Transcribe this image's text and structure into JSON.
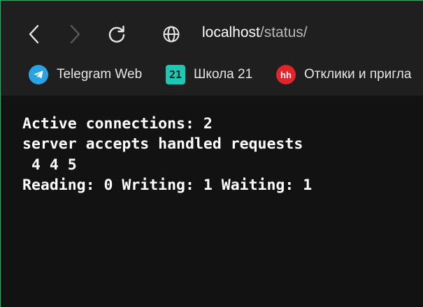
{
  "browser": {
    "url_host": "localhost",
    "url_path": "/status/",
    "nav": {
      "back": "back-arrow-icon",
      "forward": "forward-arrow-icon",
      "reload": "reload-icon",
      "site_info": "globe-icon"
    }
  },
  "bookmarks": [
    {
      "label": "Telegram Web",
      "icon": "telegram-icon",
      "color": "#2aa3e4"
    },
    {
      "label": "Школа 21",
      "icon": "school21-icon",
      "icon_text": "21",
      "color": "#1ec7b1"
    },
    {
      "label": "Отклики и пригла",
      "icon": "hh-icon",
      "icon_text": "hh",
      "color": "#e3242b"
    }
  ],
  "page": {
    "lines": [
      "Active connections: 2",
      "server accepts handled requests",
      " 4 4 5",
      "Reading: 0 Writing: 1 Waiting: 1"
    ]
  },
  "colors": {
    "background": "#121212",
    "chrome": "#1f1f1f",
    "accent_border": "#3aa66a"
  }
}
